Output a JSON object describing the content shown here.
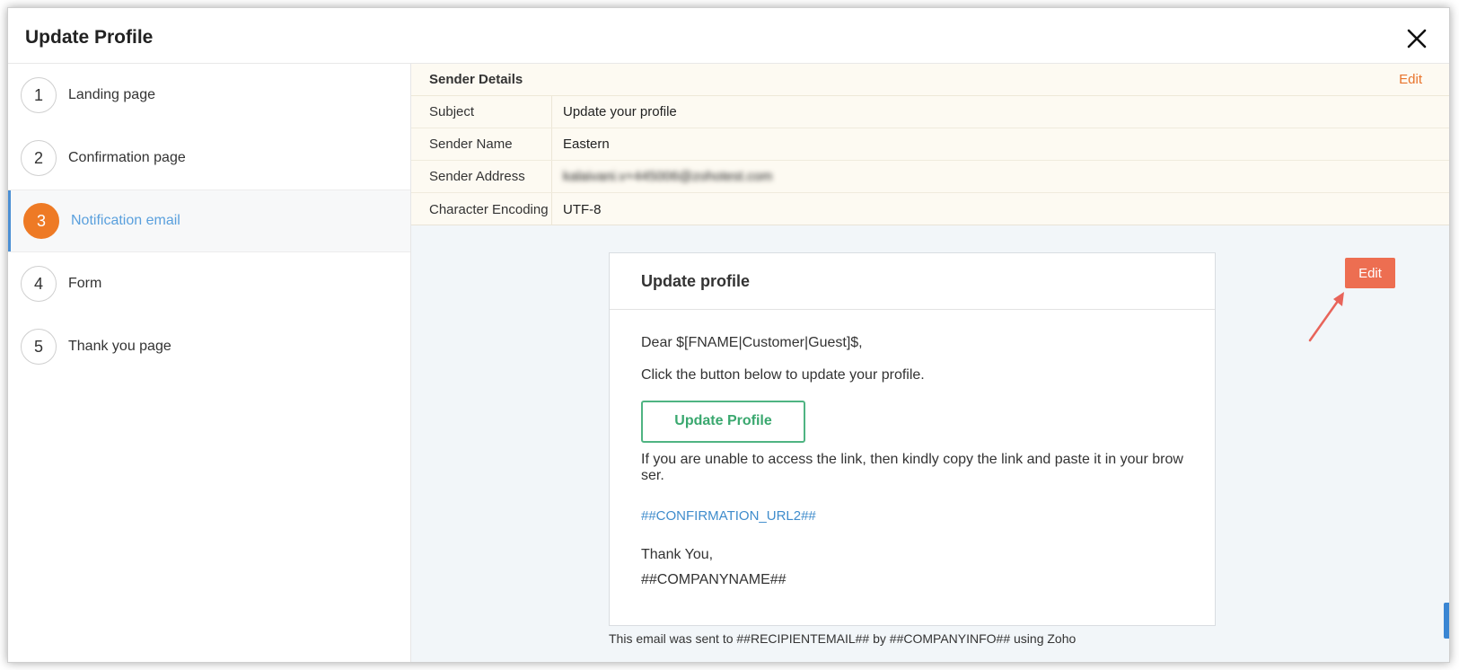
{
  "modal": {
    "title": "Update Profile"
  },
  "steps": [
    {
      "num": "1",
      "label": "Landing page"
    },
    {
      "num": "2",
      "label": "Confirmation page"
    },
    {
      "num": "3",
      "label": "Notification email"
    },
    {
      "num": "4",
      "label": "Form"
    },
    {
      "num": "5",
      "label": "Thank you page"
    }
  ],
  "sender": {
    "title": "Sender Details",
    "edit_label": "Edit",
    "rows": [
      {
        "key": "Subject",
        "value": "Update your profile"
      },
      {
        "key": "Sender Name",
        "value": "Eastern"
      },
      {
        "key": "Sender Address",
        "value": "kalaivani.v+445006@zohotest.com"
      },
      {
        "key": "Character Encoding",
        "value": "UTF-8"
      }
    ]
  },
  "email": {
    "title": "Update profile",
    "greeting": "Dear $[FNAME|Customer|Guest]$,",
    "instruction": "Click the button below to update your profile.",
    "button_label": "Update Profile",
    "help_text": "If you are unable to access the link, then kindly copy the link and paste it in your browser.",
    "url": "##CONFIRMATION_URL2##",
    "thanks": "Thank You,",
    "company": "##COMPANYNAME##",
    "footer": "This email was sent to ##RECIPIENTEMAIL## by ##COMPANYINFO## using Zoho"
  },
  "edit_button": {
    "label": "Edit"
  },
  "colors": {
    "accent": "#ee7a25",
    "edit_button": "#ed6e51",
    "link": "#3f8ccc",
    "active_label": "#5aa0dd",
    "button_green": "#3aa86f"
  }
}
